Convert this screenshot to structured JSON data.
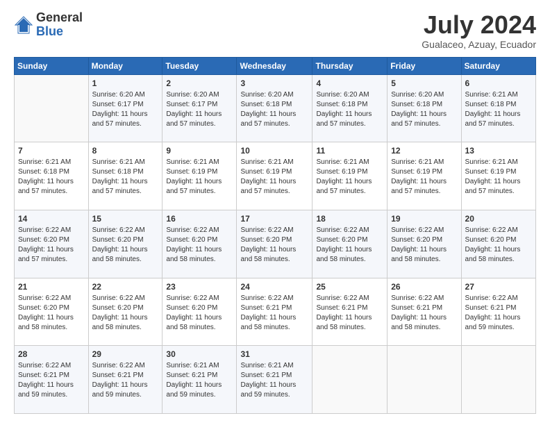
{
  "logo": {
    "general": "General",
    "blue": "Blue"
  },
  "header": {
    "month": "July 2024",
    "location": "Gualaceo, Azuay, Ecuador"
  },
  "weekdays": [
    "Sunday",
    "Monday",
    "Tuesday",
    "Wednesday",
    "Thursday",
    "Friday",
    "Saturday"
  ],
  "weeks": [
    [
      {
        "day": "",
        "info": ""
      },
      {
        "day": "1",
        "info": "Sunrise: 6:20 AM\nSunset: 6:17 PM\nDaylight: 11 hours\nand 57 minutes."
      },
      {
        "day": "2",
        "info": "Sunrise: 6:20 AM\nSunset: 6:17 PM\nDaylight: 11 hours\nand 57 minutes."
      },
      {
        "day": "3",
        "info": "Sunrise: 6:20 AM\nSunset: 6:18 PM\nDaylight: 11 hours\nand 57 minutes."
      },
      {
        "day": "4",
        "info": "Sunrise: 6:20 AM\nSunset: 6:18 PM\nDaylight: 11 hours\nand 57 minutes."
      },
      {
        "day": "5",
        "info": "Sunrise: 6:20 AM\nSunset: 6:18 PM\nDaylight: 11 hours\nand 57 minutes."
      },
      {
        "day": "6",
        "info": "Sunrise: 6:21 AM\nSunset: 6:18 PM\nDaylight: 11 hours\nand 57 minutes."
      }
    ],
    [
      {
        "day": "7",
        "info": "Sunrise: 6:21 AM\nSunset: 6:18 PM\nDaylight: 11 hours\nand 57 minutes."
      },
      {
        "day": "8",
        "info": "Sunrise: 6:21 AM\nSunset: 6:18 PM\nDaylight: 11 hours\nand 57 minutes."
      },
      {
        "day": "9",
        "info": "Sunrise: 6:21 AM\nSunset: 6:19 PM\nDaylight: 11 hours\nand 57 minutes."
      },
      {
        "day": "10",
        "info": "Sunrise: 6:21 AM\nSunset: 6:19 PM\nDaylight: 11 hours\nand 57 minutes."
      },
      {
        "day": "11",
        "info": "Sunrise: 6:21 AM\nSunset: 6:19 PM\nDaylight: 11 hours\nand 57 minutes."
      },
      {
        "day": "12",
        "info": "Sunrise: 6:21 AM\nSunset: 6:19 PM\nDaylight: 11 hours\nand 57 minutes."
      },
      {
        "day": "13",
        "info": "Sunrise: 6:21 AM\nSunset: 6:19 PM\nDaylight: 11 hours\nand 57 minutes."
      }
    ],
    [
      {
        "day": "14",
        "info": "Sunrise: 6:22 AM\nSunset: 6:20 PM\nDaylight: 11 hours\nand 57 minutes."
      },
      {
        "day": "15",
        "info": "Sunrise: 6:22 AM\nSunset: 6:20 PM\nDaylight: 11 hours\nand 58 minutes."
      },
      {
        "day": "16",
        "info": "Sunrise: 6:22 AM\nSunset: 6:20 PM\nDaylight: 11 hours\nand 58 minutes."
      },
      {
        "day": "17",
        "info": "Sunrise: 6:22 AM\nSunset: 6:20 PM\nDaylight: 11 hours\nand 58 minutes."
      },
      {
        "day": "18",
        "info": "Sunrise: 6:22 AM\nSunset: 6:20 PM\nDaylight: 11 hours\nand 58 minutes."
      },
      {
        "day": "19",
        "info": "Sunrise: 6:22 AM\nSunset: 6:20 PM\nDaylight: 11 hours\nand 58 minutes."
      },
      {
        "day": "20",
        "info": "Sunrise: 6:22 AM\nSunset: 6:20 PM\nDaylight: 11 hours\nand 58 minutes."
      }
    ],
    [
      {
        "day": "21",
        "info": "Sunrise: 6:22 AM\nSunset: 6:20 PM\nDaylight: 11 hours\nand 58 minutes."
      },
      {
        "day": "22",
        "info": "Sunrise: 6:22 AM\nSunset: 6:20 PM\nDaylight: 11 hours\nand 58 minutes."
      },
      {
        "day": "23",
        "info": "Sunrise: 6:22 AM\nSunset: 6:20 PM\nDaylight: 11 hours\nand 58 minutes."
      },
      {
        "day": "24",
        "info": "Sunrise: 6:22 AM\nSunset: 6:21 PM\nDaylight: 11 hours\nand 58 minutes."
      },
      {
        "day": "25",
        "info": "Sunrise: 6:22 AM\nSunset: 6:21 PM\nDaylight: 11 hours\nand 58 minutes."
      },
      {
        "day": "26",
        "info": "Sunrise: 6:22 AM\nSunset: 6:21 PM\nDaylight: 11 hours\nand 58 minutes."
      },
      {
        "day": "27",
        "info": "Sunrise: 6:22 AM\nSunset: 6:21 PM\nDaylight: 11 hours\nand 59 minutes."
      }
    ],
    [
      {
        "day": "28",
        "info": "Sunrise: 6:22 AM\nSunset: 6:21 PM\nDaylight: 11 hours\nand 59 minutes."
      },
      {
        "day": "29",
        "info": "Sunrise: 6:22 AM\nSunset: 6:21 PM\nDaylight: 11 hours\nand 59 minutes."
      },
      {
        "day": "30",
        "info": "Sunrise: 6:21 AM\nSunset: 6:21 PM\nDaylight: 11 hours\nand 59 minutes."
      },
      {
        "day": "31",
        "info": "Sunrise: 6:21 AM\nSunset: 6:21 PM\nDaylight: 11 hours\nand 59 minutes."
      },
      {
        "day": "",
        "info": ""
      },
      {
        "day": "",
        "info": ""
      },
      {
        "day": "",
        "info": ""
      }
    ]
  ]
}
